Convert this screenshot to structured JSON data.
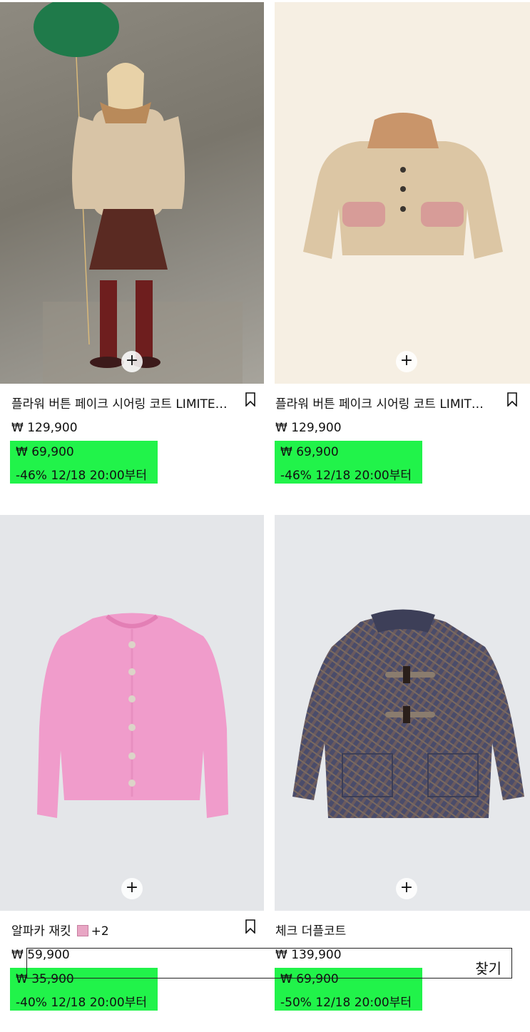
{
  "products": [
    {
      "name": "플라워 버튼 페이크 시어링 코트 LIMITED EDITION",
      "original_price": "₩ 129,900",
      "sale_price": "₩ 69,900",
      "discount": "-46% 12/18 20:00부터"
    },
    {
      "name": "플라워 버튼 페이크 시어링 코트 LIMITED EDITION",
      "original_price": "₩ 129,900",
      "sale_price": "₩ 69,900",
      "discount": "-46% 12/18 20:00부터"
    },
    {
      "name": "알파카 재킷",
      "more_colors": "+2",
      "original_price": "₩ 59,900",
      "sale_price": "₩ 35,900",
      "discount": "-40% 12/18 20:00부터"
    },
    {
      "name": "체크 더플코트",
      "original_price": "₩ 139,900",
      "sale_price": "₩ 69,900",
      "discount": "-50% 12/18 20:00부터"
    }
  ],
  "search": {
    "label": "찾기"
  },
  "icons": {
    "add": "plus-icon",
    "save": "bookmark-icon"
  },
  "colors": {
    "sale_highlight": "#21f34a",
    "swatch_pink": "#e8a6c4"
  }
}
